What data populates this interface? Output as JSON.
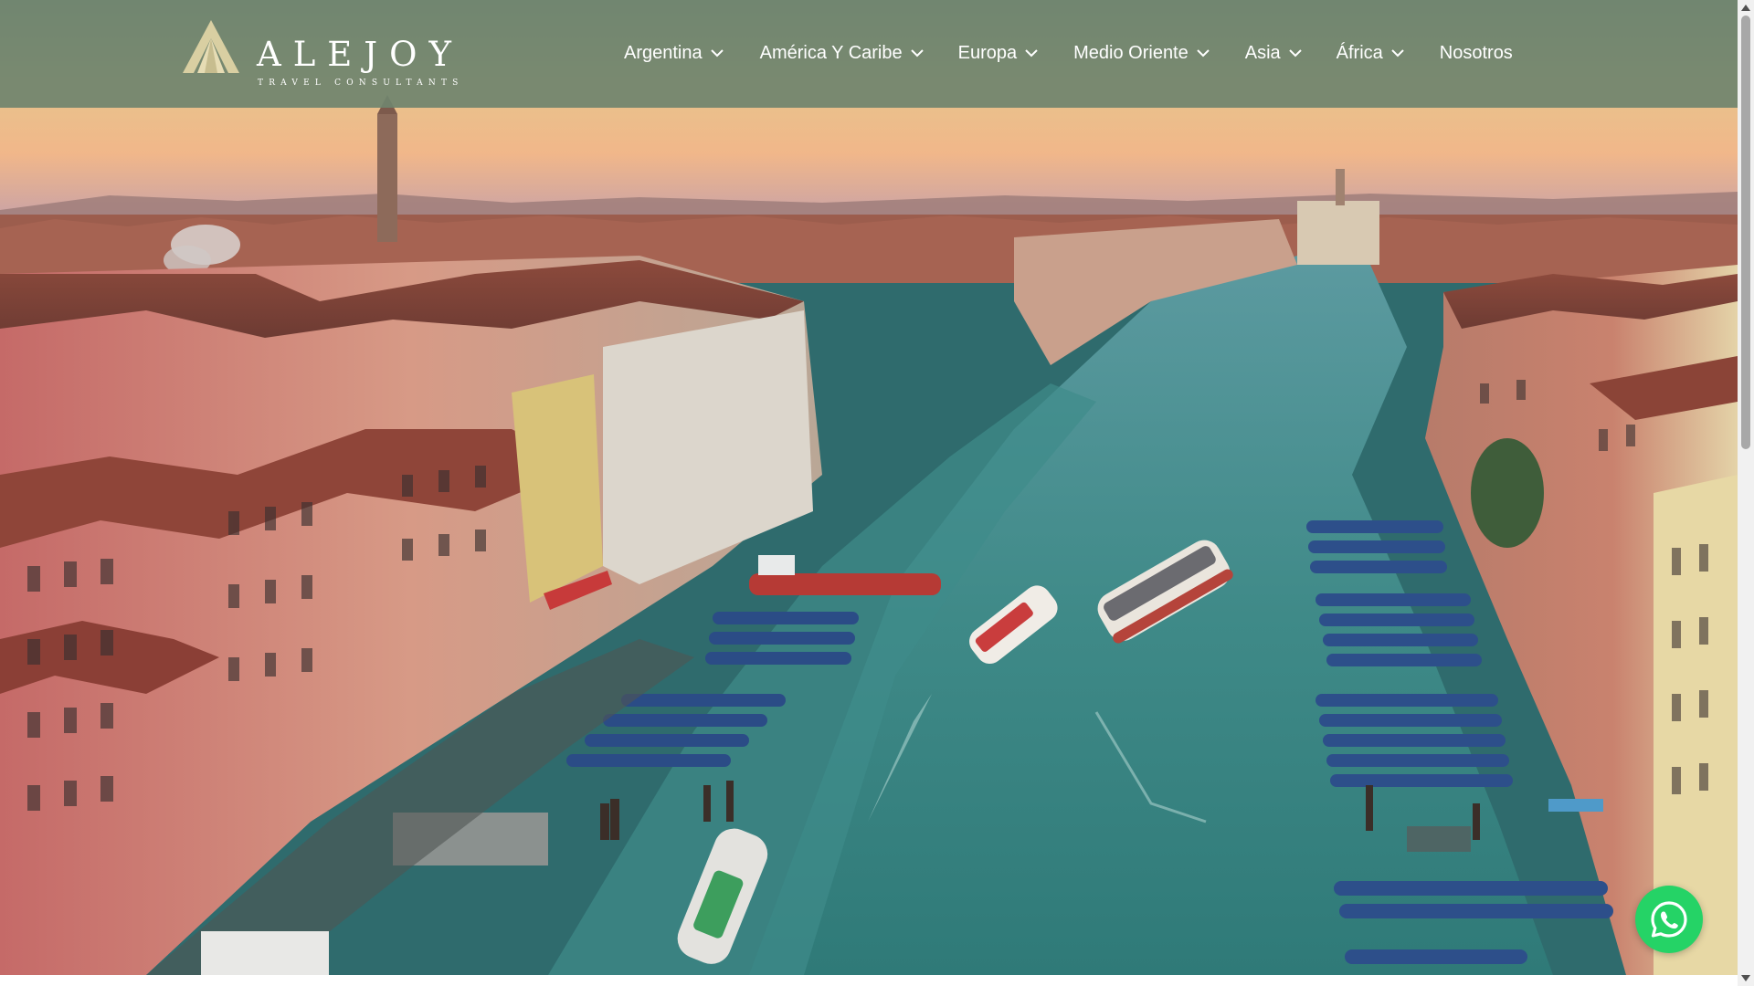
{
  "brand": {
    "name": "ALEJOY",
    "tagline": "TRAVEL CONSULTANTS",
    "logo_icon": "mountain-peak-logo",
    "logo_color": "#d9cfa2"
  },
  "header": {
    "background": "#70846e",
    "text_color": "#ffffff"
  },
  "nav": {
    "items": [
      {
        "label": "Argentina",
        "has_dropdown": true,
        "icon": "chevron-down-icon"
      },
      {
        "label": "América Y Caribe",
        "has_dropdown": true,
        "icon": "chevron-down-icon"
      },
      {
        "label": "Europa",
        "has_dropdown": true,
        "icon": "chevron-down-icon"
      },
      {
        "label": "Medio Oriente",
        "has_dropdown": true,
        "icon": "chevron-down-icon"
      },
      {
        "label": "Asia",
        "has_dropdown": true,
        "icon": "chevron-down-icon"
      },
      {
        "label": "África",
        "has_dropdown": true,
        "icon": "chevron-down-icon"
      },
      {
        "label": "Nosotros",
        "has_dropdown": false
      }
    ]
  },
  "hero": {
    "scene": "aerial view of a canal city at sunset"
  },
  "whatsapp": {
    "icon": "whatsapp-icon",
    "color": "#25d366"
  }
}
